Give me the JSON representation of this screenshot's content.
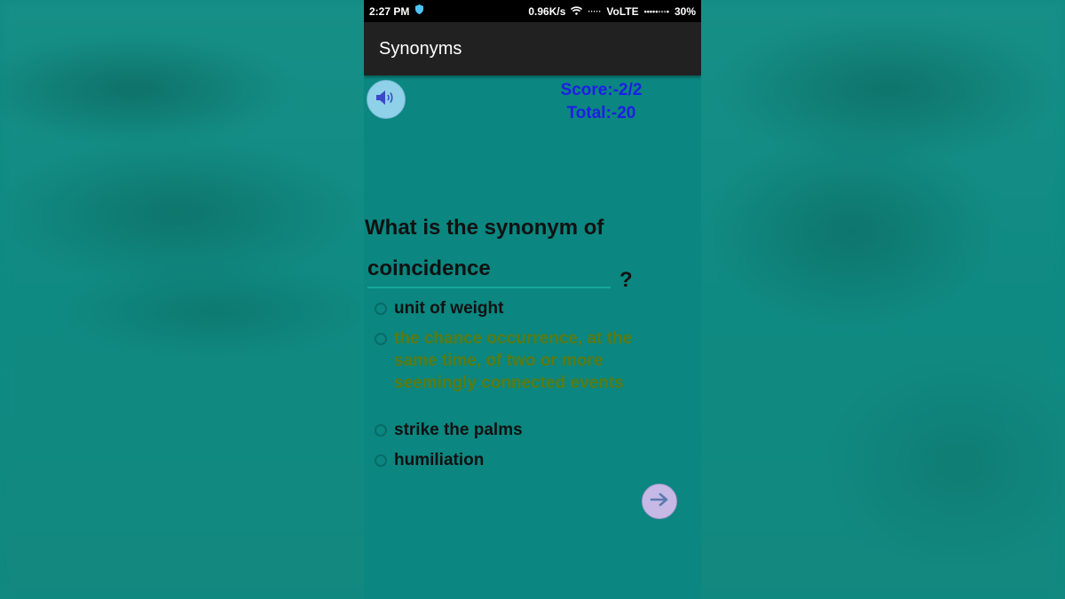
{
  "status_bar": {
    "time": "2:27 PM",
    "speed": "0.96K/s",
    "network": "VoLTE",
    "battery": "30%"
  },
  "app_bar": {
    "title": "Synonyms"
  },
  "score": {
    "score_text": "Score:-2/2",
    "total_text": "Total:-20",
    "color": "#1e1ee6"
  },
  "question": {
    "prompt": "What is the synonym  of",
    "word": "coincidence",
    "question_mark": "?"
  },
  "options": [
    {
      "label": "unit of weight",
      "correct": false
    },
    {
      "label": "the chance occurrence, at the same time, of two or more seemingly connected events",
      "correct": true
    },
    {
      "label": "strike the palms",
      "correct": false
    },
    {
      "label": "humiliation",
      "correct": false
    }
  ],
  "colors": {
    "background": "#0b8680",
    "app_bar": "#212121",
    "correct_answer": "#5a7a12"
  },
  "icons": {
    "speaker": "speaker-icon",
    "next": "arrow-right-icon"
  }
}
